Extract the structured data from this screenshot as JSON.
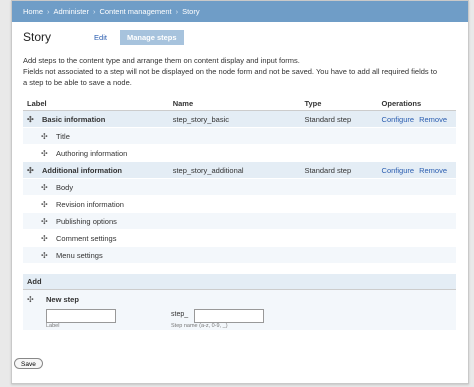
{
  "breadcrumb": [
    "Home",
    "Administer",
    "Content management",
    "Story"
  ],
  "page": {
    "title": "Story",
    "tabs": [
      {
        "label": "Edit",
        "active": false
      },
      {
        "label": "Manage steps",
        "active": true
      }
    ],
    "description": [
      "Add steps to the content type and arrange them on content display and input forms.",
      "Fields not associated to a step will not be displayed on the node form and not be saved. You have to add all required fields to",
      "a step to be able to save a node."
    ]
  },
  "table": {
    "headers": [
      "Label",
      "Name",
      "Type",
      "Operations"
    ],
    "rows": [
      {
        "kind": "group",
        "label": "Basic information",
        "name": "step_story_basic",
        "type": "Standard step",
        "ops": [
          "Configure",
          "Remove"
        ]
      },
      {
        "kind": "child",
        "label": "Title"
      },
      {
        "kind": "child",
        "label": "Authoring information"
      },
      {
        "kind": "group",
        "label": "Additional information",
        "name": "step_story_additional",
        "type": "Standard step",
        "ops": [
          "Configure",
          "Remove"
        ]
      },
      {
        "kind": "child",
        "label": "Body"
      },
      {
        "kind": "child",
        "label": "Revision information"
      },
      {
        "kind": "child",
        "label": "Publishing options"
      },
      {
        "kind": "child",
        "label": "Comment settings"
      },
      {
        "kind": "child",
        "label": "Menu settings"
      }
    ]
  },
  "add": {
    "header": "Add",
    "new_step_label": "New step",
    "label_value": "",
    "label_caption": "Label",
    "name_prefix": "step_",
    "name_value": "",
    "name_caption": "Step name (a-z, 0-9, _)"
  },
  "save_label": "Save",
  "colors": {
    "breadcrumb_bg": "#6f9dc7",
    "active_tab_bg": "#a7c3dd",
    "link": "#2a5db0"
  },
  "icons": {
    "drag_handle": "move-handle-icon"
  }
}
